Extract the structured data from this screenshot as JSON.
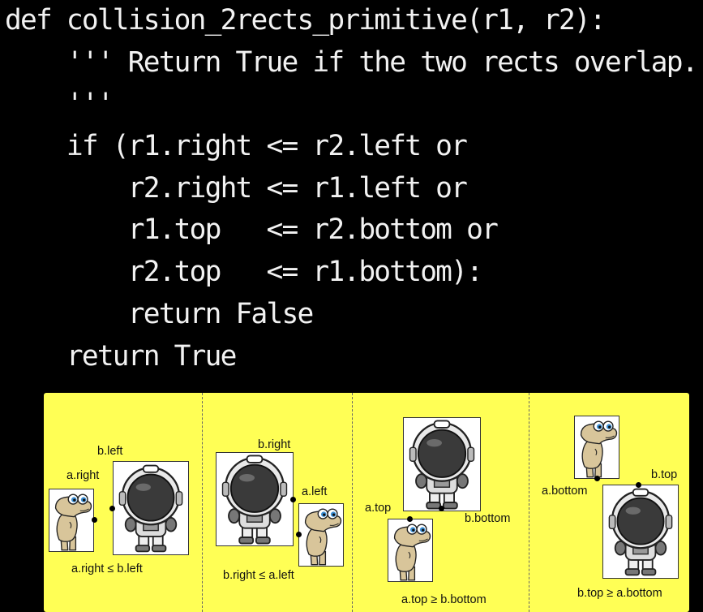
{
  "code": {
    "lines": [
      "def collision_2rects_primitive(r1, r2):",
      "    ''' Return True if the two rects overlap.",
      "    '''",
      "    if (r1.right <= r2.left or",
      "        r2.right <= r1.left or",
      "        r1.top   <= r2.bottom or",
      "        r2.top   <= r1.bottom):",
      "        return False",
      "    return True"
    ]
  },
  "diagram": {
    "panel_color": "#ffff55",
    "cases": [
      {
        "label_a": "a.right",
        "label_b": "b.left",
        "condition": "a.right ≤ b.left"
      },
      {
        "label_a": "a.left",
        "label_b": "b.right",
        "condition": "b.right ≤ a.left"
      },
      {
        "label_a": "a.top",
        "label_b": "b.bottom",
        "condition": "a.top ≥ b.bottom"
      },
      {
        "label_a": "a.bottom",
        "label_b": "b.top",
        "condition": "b.top ≥ a.bottom"
      }
    ]
  }
}
